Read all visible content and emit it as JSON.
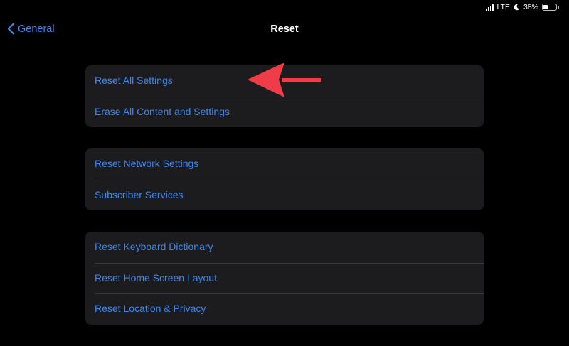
{
  "status_bar": {
    "network": "LTE",
    "battery_percent": "38%",
    "battery_level": 0.38,
    "icons": [
      "signal-icon",
      "moon-icon",
      "battery-icon"
    ]
  },
  "nav": {
    "back_label": "General",
    "title": "Reset"
  },
  "groups": [
    {
      "items": [
        "Reset All Settings",
        "Erase All Content and Settings"
      ]
    },
    {
      "items": [
        "Reset Network Settings",
        "Subscriber Services"
      ]
    },
    {
      "items": [
        "Reset Keyboard Dictionary",
        "Reset Home Screen Layout",
        "Reset Location & Privacy"
      ]
    }
  ],
  "colors": {
    "background": "#000000",
    "group_background": "#1c1c1e",
    "link_blue": "#3c86f0",
    "separator": "#38383a",
    "annotation_arrow": "#f03c46"
  }
}
